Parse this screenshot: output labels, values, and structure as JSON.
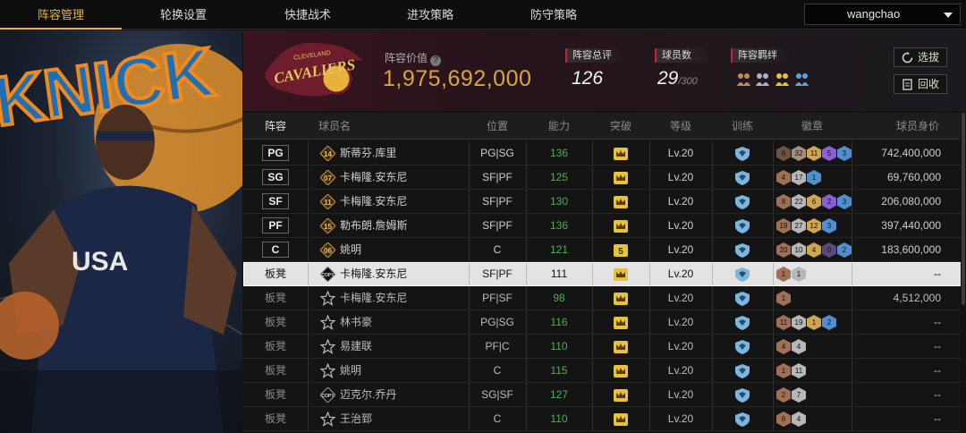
{
  "tabs": [
    {
      "label": "阵容管理",
      "active": true
    },
    {
      "label": "轮换设置",
      "active": false
    },
    {
      "label": "快捷战术",
      "active": false
    },
    {
      "label": "进攻策略",
      "active": false
    },
    {
      "label": "防守策略",
      "active": false
    }
  ],
  "user": {
    "name": "wangchao"
  },
  "team": {
    "logo_text": "CAVALIERS",
    "logo_sub": "CLEVELAND",
    "value_label": "阵容价值",
    "value": "1,975,692,000",
    "rating_label": "阵容总评",
    "rating": "126",
    "player_count_label": "球员数",
    "player_count": "29",
    "player_count_max": "/300",
    "bond_label": "阵容羁绊",
    "buttons": {
      "select": "选拔",
      "recycle": "回收"
    }
  },
  "table": {
    "headers": [
      "阵容",
      "球员名",
      "位置",
      "能力",
      "突破",
      "等级",
      "训练",
      "徽章",
      "球员身价"
    ],
    "rows": [
      {
        "slot": "PG",
        "role_badge": "14",
        "name": "斯蒂芬.库里",
        "pos": "PG|SG",
        "ability": "136",
        "breakthrough": "crown",
        "level": "Lv.20",
        "badges": [
          {
            "v": "6",
            "c": "#6b5442"
          },
          {
            "v": "32",
            "c": "#a58e7b"
          },
          {
            "v": "11",
            "c": "#cfa54e"
          },
          {
            "v": "5",
            "c": "#8b5fcf"
          },
          {
            "v": "3",
            "c": "#4f8fcf"
          }
        ],
        "salary": "742,400,000"
      },
      {
        "slot": "SG",
        "role_badge": "07",
        "name": "卡梅隆.安东尼",
        "pos": "SF|PF",
        "ability": "125",
        "breakthrough": "crown",
        "level": "Lv.20",
        "badges": [
          {
            "v": "4",
            "c": "#a07055"
          },
          {
            "v": "17",
            "c": "#b7b7b7"
          },
          {
            "v": "1",
            "c": "#4f8fcf"
          }
        ],
        "salary": "69,760,000"
      },
      {
        "slot": "SF",
        "role_badge": "11",
        "name": "卡梅隆.安东尼",
        "pos": "SF|PF",
        "ability": "130",
        "breakthrough": "crown",
        "level": "Lv.20",
        "badges": [
          {
            "v": "8",
            "c": "#a07055"
          },
          {
            "v": "22",
            "c": "#b7b7b7"
          },
          {
            "v": "6",
            "c": "#cfa54e"
          },
          {
            "v": "2",
            "c": "#8b5fcf"
          },
          {
            "v": "3",
            "c": "#4f8fcf"
          }
        ],
        "salary": "206,080,000"
      },
      {
        "slot": "PF",
        "role_badge": "15",
        "name": "勒布朗.詹姆斯",
        "pos": "SF|PF",
        "ability": "136",
        "breakthrough": "crown",
        "level": "Lv.20",
        "badges": [
          {
            "v": "19",
            "c": "#a07055"
          },
          {
            "v": "27",
            "c": "#b7b7b7"
          },
          {
            "v": "12",
            "c": "#cfa54e"
          },
          {
            "v": "3",
            "c": "#4f8fcf"
          }
        ],
        "salary": "397,440,000"
      },
      {
        "slot": "C",
        "role_badge": "06",
        "name": "姚明",
        "pos": "C",
        "ability": "121",
        "breakthrough": "5",
        "level": "Lv.20",
        "badges": [
          {
            "v": "20",
            "c": "#a07055"
          },
          {
            "v": "10",
            "c": "#b7b7b7"
          },
          {
            "v": "4",
            "c": "#cfa54e"
          },
          {
            "v": "0",
            "c": "#5a4a7a"
          },
          {
            "v": "2",
            "c": "#4f8fcf"
          }
        ],
        "salary": "183,600,000"
      },
      {
        "slot": "板凳",
        "role_badge": "COPY",
        "name": "卡梅隆.安东尼",
        "pos": "SF|PF",
        "ability": "111",
        "breakthrough": "crown",
        "level": "Lv.20",
        "badges": [
          {
            "v": "1",
            "c": "#a07055"
          },
          {
            "v": "1",
            "c": "#b7b7b7"
          }
        ],
        "salary": "--",
        "selected": true
      },
      {
        "slot": "板凳",
        "role_badge": "",
        "name": "卡梅隆.安东尼",
        "pos": "PF|SF",
        "ability": "98",
        "breakthrough": "crown",
        "level": "Lv.20",
        "badges": [
          {
            "v": "1",
            "c": "#a07055"
          }
        ],
        "salary": "4,512,000"
      },
      {
        "slot": "板凳",
        "role_badge": "",
        "name": "林书豪",
        "pos": "PG|SG",
        "ability": "116",
        "breakthrough": "crown",
        "level": "Lv.20",
        "badges": [
          {
            "v": "11",
            "c": "#a07055"
          },
          {
            "v": "19",
            "c": "#b7b7b7"
          },
          {
            "v": "1",
            "c": "#cfa54e"
          },
          {
            "v": "2",
            "c": "#4f8fcf"
          }
        ],
        "salary": "--"
      },
      {
        "slot": "板凳",
        "role_badge": "",
        "name": "易建联",
        "pos": "PF|C",
        "ability": "110",
        "breakthrough": "crown",
        "level": "Lv.20",
        "badges": [
          {
            "v": "4",
            "c": "#a07055"
          },
          {
            "v": "4",
            "c": "#b7b7b7"
          }
        ],
        "salary": "--"
      },
      {
        "slot": "板凳",
        "role_badge": "",
        "name": "姚明",
        "pos": "C",
        "ability": "115",
        "breakthrough": "crown",
        "level": "Lv.20",
        "badges": [
          {
            "v": "1",
            "c": "#a07055"
          },
          {
            "v": "11",
            "c": "#b7b7b7"
          }
        ],
        "salary": "--"
      },
      {
        "slot": "板凳",
        "role_badge": "COPY",
        "name": "迈克尔.乔丹",
        "pos": "SG|SF",
        "ability": "127",
        "breakthrough": "crown",
        "level": "Lv.20",
        "badges": [
          {
            "v": "2",
            "c": "#a07055"
          },
          {
            "v": "7",
            "c": "#b7b7b7"
          }
        ],
        "salary": "--"
      },
      {
        "slot": "板凳",
        "role_badge": "",
        "name": "王治郅",
        "pos": "C",
        "ability": "110",
        "breakthrough": "crown",
        "level": "Lv.20",
        "badges": [
          {
            "v": "6",
            "c": "#a07055"
          },
          {
            "v": "4",
            "c": "#b7b7b7"
          }
        ],
        "salary": "--"
      }
    ]
  },
  "colors": {
    "accent": "#f0b030",
    "value_gold": "#d9a441",
    "ability_green": "#4caf50"
  }
}
